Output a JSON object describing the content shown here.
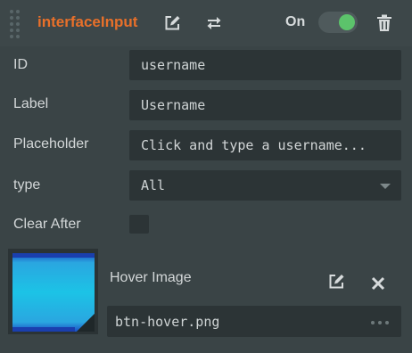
{
  "header": {
    "title": "interfaceInput",
    "toggle_label": "On",
    "toggle_state": "on",
    "icons": [
      "edit-icon",
      "swap-icon",
      "trash-icon"
    ]
  },
  "fields": {
    "id_label": "ID",
    "id_value": "username",
    "label_label": "Label",
    "label_value": "Username",
    "placeholder_label": "Placeholder",
    "placeholder_value": "Click and type a username...",
    "type_label": "type",
    "type_value": "All",
    "clear_after_label": "Clear After",
    "clear_after_checked": false
  },
  "hover_image": {
    "label": "Hover Image",
    "file": "btn-hover.png",
    "icons": [
      "edit-icon",
      "close-icon",
      "more-icon"
    ]
  },
  "colors": {
    "accent": "#e8702a",
    "toggle_on": "#5cc36b",
    "panel_bg": "#3a4446",
    "field_bg": "#2c3436"
  }
}
